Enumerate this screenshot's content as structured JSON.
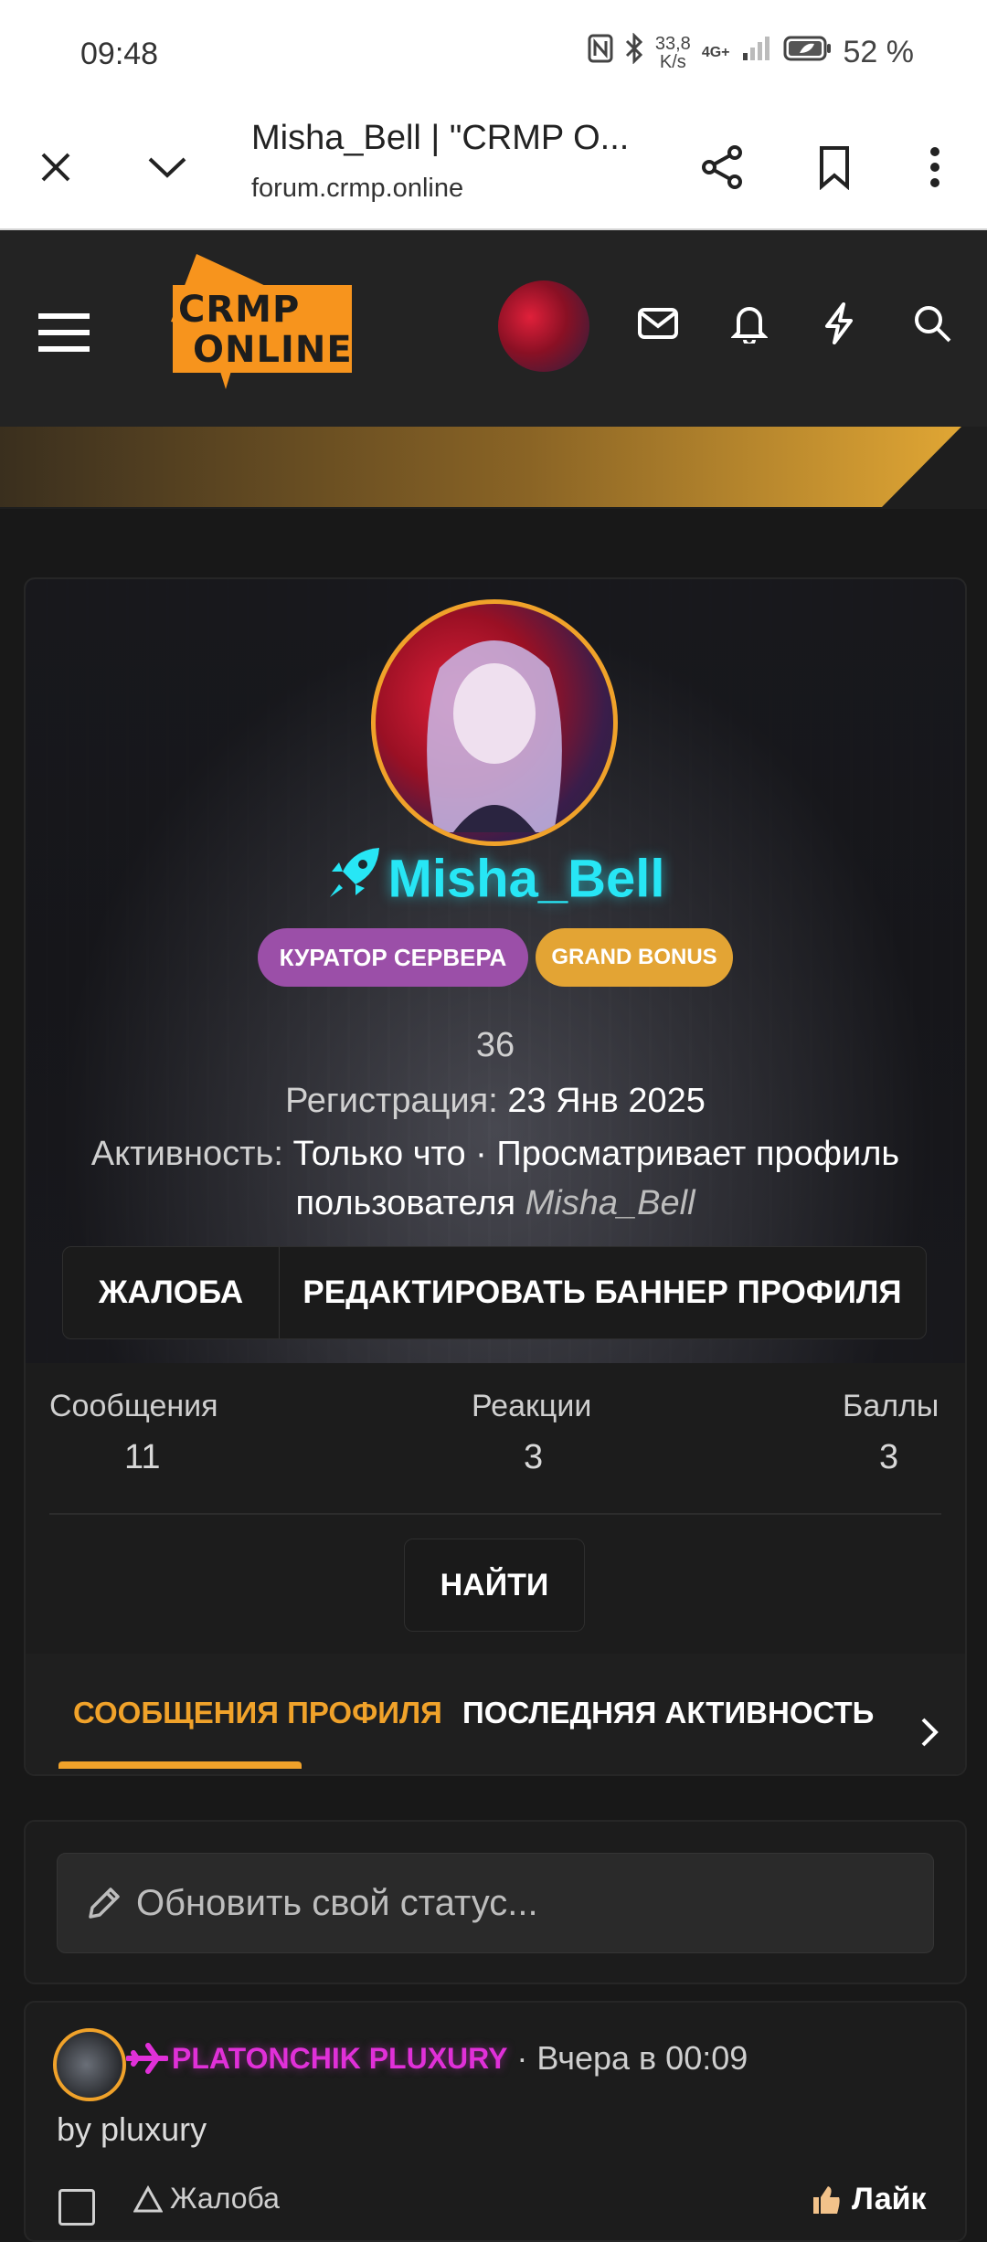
{
  "status_bar": {
    "time": "09:48",
    "net_speed_value": "33,8",
    "net_speed_unit": "K/s",
    "network": "4G+",
    "battery": "52 %"
  },
  "browser": {
    "tab_title": "Misha_Bell | \"CRMP O...",
    "url": "forum.crmp.online"
  },
  "site": {
    "logo_line1": "CRMP",
    "logo_line2": "ONLINE"
  },
  "profile": {
    "username": "Misha_Bell",
    "badges": [
      {
        "label": "КУРАТОР СЕРВЕРА",
        "color": "#9b4fa8"
      },
      {
        "label": "GRAND BONUS",
        "color": "#e3a434"
      }
    ],
    "id_number": "36",
    "registration_label": "Регистрация:",
    "registration_value": "23 Янв 2025",
    "activity_label": "Активность:",
    "activity_value_line1": "Только что · Просматривает профиль",
    "activity_value_line2": "пользователя",
    "activity_value_user": "Misha_Bell",
    "report_button": "ЖАЛОБА",
    "edit_banner_button": "РЕДАКТИРОВАТЬ БАННЕР ПРОФИЛЯ"
  },
  "stats": {
    "messages_label": "Сообщения",
    "messages_value": "11",
    "reactions_label": "Реакции",
    "reactions_value": "3",
    "points_label": "Баллы",
    "points_value": "3"
  },
  "find_button": "НАЙТИ",
  "tabs": [
    {
      "label": "СООБЩЕНИЯ ПРОФИЛЯ",
      "active": true
    },
    {
      "label": "ПОСЛЕДНЯЯ АКТИВНОСТЬ",
      "active": false
    }
  ],
  "status_input_placeholder": "Обновить свой статус...",
  "post": {
    "author": "PLATONCHIK PLUXURY",
    "time": "· Вчера в 00:09",
    "text": "by pluxury",
    "report_label": "Жалоба",
    "like_label": "Лайк"
  },
  "colors": {
    "accent": "#f0a22a",
    "username": "#27e6f5",
    "post_author": "#e030d8"
  }
}
